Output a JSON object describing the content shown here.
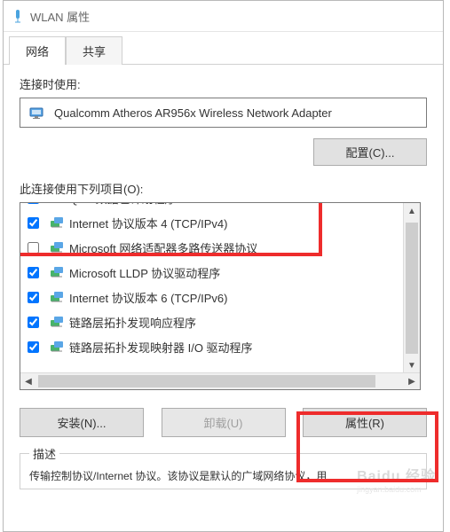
{
  "window": {
    "title": "WLAN 属性"
  },
  "tabs": {
    "active": "网络",
    "inactive": "共享"
  },
  "connect_label": "连接时使用:",
  "adapter": {
    "name": "Qualcomm Atheros AR956x Wireless Network Adapter"
  },
  "configure_btn": "配置(C)...",
  "items_label": "此连接使用下列项目(O):",
  "items": [
    {
      "checked": true,
      "icon": "net",
      "label": "QoS 数据包计划程序"
    },
    {
      "checked": true,
      "icon": "ipv4",
      "label": "Internet 协议版本 4 (TCP/IPv4)"
    },
    {
      "checked": false,
      "icon": "net",
      "label": "Microsoft 网络适配器多路传送器协议"
    },
    {
      "checked": true,
      "icon": "lldp",
      "label": "Microsoft LLDP 协议驱动程序"
    },
    {
      "checked": true,
      "icon": "ipv6",
      "label": "Internet 协议版本 6 (TCP/IPv6)"
    },
    {
      "checked": true,
      "icon": "lltd",
      "label": "链路层拓扑发现响应程序"
    },
    {
      "checked": true,
      "icon": "lltd",
      "label": "链路层拓扑发现映射器 I/O 驱动程序"
    }
  ],
  "buttons": {
    "install": "安装(N)...",
    "uninstall": "卸载(U)",
    "properties": "属性(R)"
  },
  "desc": {
    "legend": "描述",
    "text": "传输控制协议/Internet 协议。该协议是默认的广域网络协议，用"
  },
  "watermark": {
    "brand": "Baidu 经验",
    "url": "jingyan.baidu.com"
  }
}
